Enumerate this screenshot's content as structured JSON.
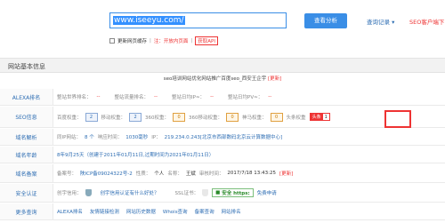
{
  "search": {
    "value": "www.iseeyu.com/",
    "query_button": "查看分析"
  },
  "header": {
    "login_record": "查询记录",
    "login_arrow": "▾",
    "seo_client": "SEO客户端下"
  },
  "options": {
    "new_label": "更新网页缓存",
    "nav_hint": "注：开放内页面",
    "api_button": "获取API"
  },
  "section": {
    "title": "网站基本信息"
  },
  "site_title": {
    "text": "seo培训网站优化网站推广百度seo_西安王企宇",
    "update": "[更新]"
  },
  "alexa": {
    "label": "ALEXA排名",
    "items": [
      {
        "k": "整站世界排名：",
        "v": "--"
      },
      {
        "k": "整站流量排名：",
        "v": "--"
      },
      {
        "k": "整站日均IP≈：",
        "v": "--"
      },
      {
        "k": "整站日均PV≈：",
        "v": "--"
      }
    ]
  },
  "seo": {
    "label": "SEO信息",
    "baidu": "百度权重：",
    "baidu_v": "2",
    "mobile": "移动权重：",
    "mobile_v": "2",
    "w360": "360权重：",
    "w360_v": "0",
    "m360": "360移动权重：",
    "m360_v": "0",
    "shenma": "神马权重：",
    "shenma_v": "0",
    "toutiao": "头条权重",
    "toutiao_badge": "头条",
    "toutiao_v": "1"
  },
  "domain": {
    "label": "域名解析",
    "ip_k": "同IP网站：",
    "ip_v": "8 个",
    "resp_k": "响应时间：",
    "resp_v": "1030毫秒",
    "ipaddr_k": "IP：",
    "ipaddr_v": "219.234.0.243[北京市西部数码北京云计算数据中心]"
  },
  "age": {
    "label": "域名年龄",
    "text": "8年9月25天（创建于2011年01月11日,过期时间为2021年01月11日）"
  },
  "icp": {
    "label": "域名备案",
    "no_k": "备案号：",
    "no_v": "陕ICP备09024322号-2",
    "type_k": "性质：",
    "type_v": "个人",
    "name_k": "名称：",
    "name_v": "王斌",
    "time_k": "审核时间：",
    "time_v": "2017/7/18 13:43:25",
    "update": "[更新]"
  },
  "security": {
    "label": "安全认证",
    "trust_k": "创宇信用：",
    "trust_link": "创宇信用认证有什么好处？",
    "ssl_k": "SSL证书：",
    "ssl_v": "安全 https:",
    "ssl_free": "免费申请"
  },
  "more": {
    "label": "更多查询",
    "links": [
      "ALEXA排名",
      "友情链接检测",
      "网站历史数据",
      "Whois查询",
      "备案查询",
      "网站排名"
    ]
  }
}
